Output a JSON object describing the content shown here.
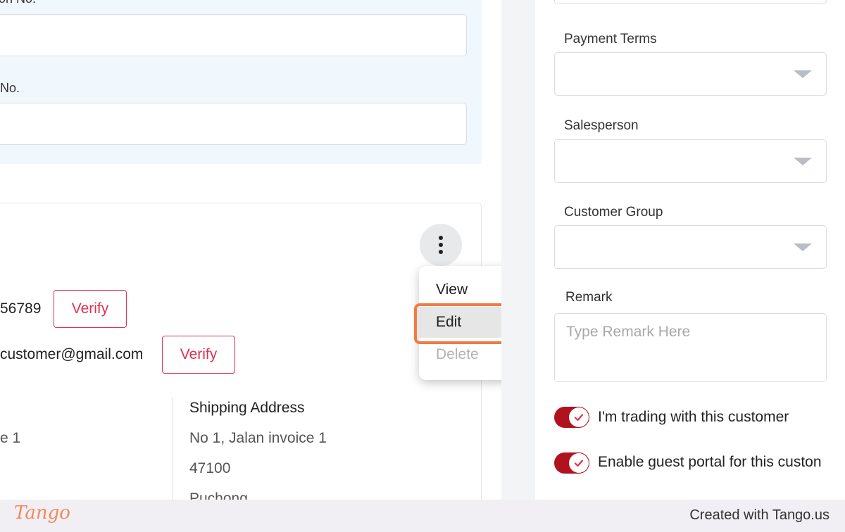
{
  "left": {
    "registration_label": "ion No.",
    "tax_label": "No.",
    "phone": "56789",
    "email": "customer@gmail.com",
    "verify_label": "Verify",
    "billing_line_1": "e 1",
    "shipping_title": "Shipping Address",
    "shipping_lines": [
      "No 1, Jalan invoice 1",
      "47100",
      "Puchong"
    ]
  },
  "menu": {
    "items": [
      {
        "label": "View"
      },
      {
        "label": "Edit"
      },
      {
        "label": "Delete"
      }
    ]
  },
  "right": {
    "payment_terms_label": "Payment Terms",
    "salesperson_label": "Salesperson",
    "customer_group_label": "Customer Group",
    "remark_label": "Remark",
    "remark_placeholder": "Type Remark Here",
    "toggle_trading_label": "I'm trading with this customer",
    "toggle_portal_label": "Enable guest portal for this custon"
  },
  "footer": {
    "brand": "Tango",
    "credit": "Created with Tango.us"
  },
  "colors": {
    "accent": "#e0304f",
    "toggle": "#b0131d",
    "highlight": "#f07b44"
  }
}
